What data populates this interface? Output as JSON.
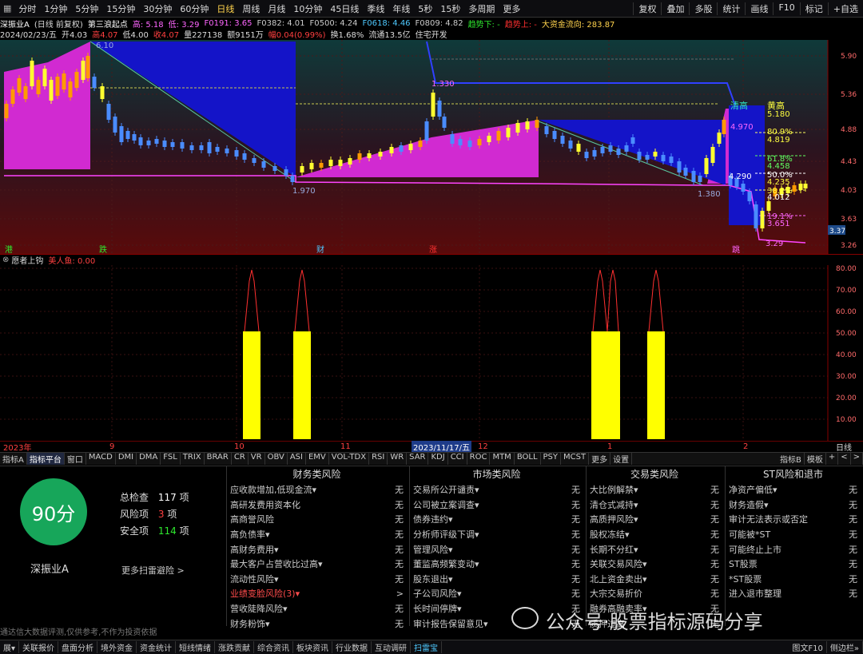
{
  "periods": [
    "分时",
    "1分钟",
    "5分钟",
    "15分钟",
    "30分钟",
    "60分钟",
    "日线",
    "周线",
    "月线",
    "10分钟",
    "45日线",
    "季线",
    "年线",
    "5秒",
    "15秒",
    "多周期",
    "更多"
  ],
  "active_period": "日线",
  "tools": [
    "复权",
    "叠加",
    "多股",
    "统计",
    "画线",
    "F10",
    "标记",
    "+自选"
  ],
  "info1": {
    "stock": "深振业A",
    "mode": "(日线 前复权)",
    "indicator": "第三浪起点",
    "i1": "高: 5.18",
    "i2": "低: 3.29",
    "i3": "F0191: 3.65",
    "i4": "F0382: 4.01",
    "i5": "F0500: 4.24",
    "i6": "F0618: 4.46",
    "i7": "F0809: 4.82",
    "i8": "趋势下: -",
    "i9": "趋势上: -",
    "i10": "大资金流向: 283.87"
  },
  "info2": {
    "date": "2024/02/23/五",
    "open": "开4.03",
    "high": "高4.07",
    "low": "低4.00",
    "close": "收4.07",
    "vol": "量227138",
    "amt": "额9151万",
    "chg": "幅0.04(0.99%)",
    "turn": "换1.68%",
    "float": "流通13.5亿",
    "tag": "住宅开发"
  },
  "main_axis": [
    "5.90",
    "5.36",
    "4.88",
    "4.43",
    "4.03",
    "3.63",
    "3.26"
  ],
  "price_marker": "3.37",
  "main_labels": {
    "p1": "6.10",
    "p2": "1.970",
    "p3": "1.330",
    "p4": "1.380",
    "p5": "3.29",
    "t1": "清高",
    "t2": "黄高",
    "t3": "5.180",
    "t4": "80.9%",
    "t5": "4.819",
    "t6": "61.8%",
    "t7": "4.458",
    "t8": "50.0%",
    "t9": "4.235",
    "t10": "38.2%",
    "t11": "4.012",
    "t12": "19.1%",
    "t13": "3.651",
    "t14": "4.970",
    "t15": "4.290",
    "s1": "港",
    "s2": "跌",
    "s3": "财",
    "s4": "涨",
    "s5": "跳"
  },
  "sub_head": {
    "name": "愿者上钩",
    "field": "美人鱼: 0.00"
  },
  "sub_axis": [
    "80.00",
    "70.00",
    "60.00",
    "50.00",
    "40.00",
    "30.00",
    "20.00",
    "10.00"
  ],
  "dates": [
    "2023年",
    "9",
    "10",
    "11",
    "2023/11/17/五",
    "12",
    "1",
    "2"
  ],
  "date_right": "日线",
  "tabs": [
    "指标A",
    "指标平台",
    "窗口",
    "MACD",
    "DMI",
    "DMA",
    "FSL",
    "TRIX",
    "BRAR",
    "CR",
    "VR",
    "OBV",
    "ASI",
    "EMV",
    "VOL-TDX",
    "RSI",
    "WR",
    "SAR",
    "KDJ",
    "CCI",
    "ROC",
    "MTM",
    "BOLL",
    "PSY",
    "MCST",
    "更多",
    "设置"
  ],
  "tabs_right": [
    "指标B",
    "模板",
    "+",
    "<",
    ">"
  ],
  "panel": {
    "score": "90分",
    "total_label": "总检查",
    "total": "117",
    "unit": "项",
    "risk_label": "风险项",
    "risk": "3",
    "safe_label": "安全项",
    "safe": "114",
    "stock": "深振业A",
    "more": "更多扫雷避险 >",
    "disclaimer": "通达信大数据评测,仅供参考,不作为投资依据",
    "watermark": "公众号·股票指标源码分享",
    "cols": [
      {
        "title": "财务类风险",
        "items": [
          {
            "n": "应收款增加,低现金流▾",
            "v": "无"
          },
          {
            "n": "高研发费用资本化",
            "v": "无"
          },
          {
            "n": "高商誉风险",
            "v": "无"
          },
          {
            "n": "高负债率▾",
            "v": "无"
          },
          {
            "n": "高财务费用▾",
            "v": "无"
          },
          {
            "n": "最大客户占营收比过高▾",
            "v": "无"
          },
          {
            "n": "流动性风险▾",
            "v": "无"
          },
          {
            "n": "业绩变脸风险(3)▾",
            "v": ">",
            "warn": true
          },
          {
            "n": "营收陡降风险▾",
            "v": "无"
          },
          {
            "n": "财务粉饰▾",
            "v": "无"
          }
        ]
      },
      {
        "title": "市场类风险",
        "items": [
          {
            "n": "交易所公开谴责▾",
            "v": "无"
          },
          {
            "n": "公司被立案调查▾",
            "v": "无"
          },
          {
            "n": "债券违约▾",
            "v": "无"
          },
          {
            "n": "分析师评级下调▾",
            "v": "无"
          },
          {
            "n": "管理风险▾",
            "v": "无"
          },
          {
            "n": "董监高频繁变动▾",
            "v": "无"
          },
          {
            "n": "股东退出▾",
            "v": "无"
          },
          {
            "n": "子公司风险▾",
            "v": "无"
          },
          {
            "n": "长时间停牌▾",
            "v": "无"
          },
          {
            "n": "审计报告保留意见▾",
            "v": "无"
          }
        ]
      },
      {
        "title": "交易类风险",
        "items": [
          {
            "n": "大比例解禁▾",
            "v": "无"
          },
          {
            "n": "清仓式减持▾",
            "v": "无"
          },
          {
            "n": "高质押风险▾",
            "v": "无"
          },
          {
            "n": "股权冻结▾",
            "v": "无"
          },
          {
            "n": "长期不分红▾",
            "v": "无"
          },
          {
            "n": "关联交易风险▾",
            "v": "无"
          },
          {
            "n": "北上资金卖出▾",
            "v": "无"
          },
          {
            "n": "大宗交易折价",
            "v": "无"
          },
          {
            "n": "融券高融卖率▾",
            "v": "无"
          },
          {
            "n": "质押过高",
            "v": "无"
          }
        ]
      },
      {
        "title": "ST风险和退市",
        "items": [
          {
            "n": "净资产偏低▾",
            "v": "无"
          },
          {
            "n": "财务造假▾",
            "v": "无"
          },
          {
            "n": "审计无法表示或否定",
            "v": "无"
          },
          {
            "n": "可能被*ST",
            "v": "无"
          },
          {
            "n": "可能终止上市",
            "v": "无"
          },
          {
            "n": "ST股票",
            "v": "无"
          },
          {
            "n": "*ST股票",
            "v": "无"
          },
          {
            "n": "进入退市整理",
            "v": "无"
          }
        ]
      }
    ]
  },
  "bottom": [
    "展▾",
    "关联报价",
    "盘面分析",
    "境外资金",
    "资金统计",
    "短线情绪",
    "涨跌贡献",
    "综合资讯",
    "板块资讯",
    "行业数据",
    "互动调研",
    "扫雷宝"
  ],
  "bottom_active": "扫雷宝",
  "bottom_right": [
    "图文F10",
    "侧边栏»"
  ],
  "colors": {
    "magenta": "#d12ad1",
    "blue": "#1010cc",
    "yellow": "#ffff00",
    "red": "#ff2020",
    "cyan": "#00e0e0",
    "green": "#17a65a"
  }
}
